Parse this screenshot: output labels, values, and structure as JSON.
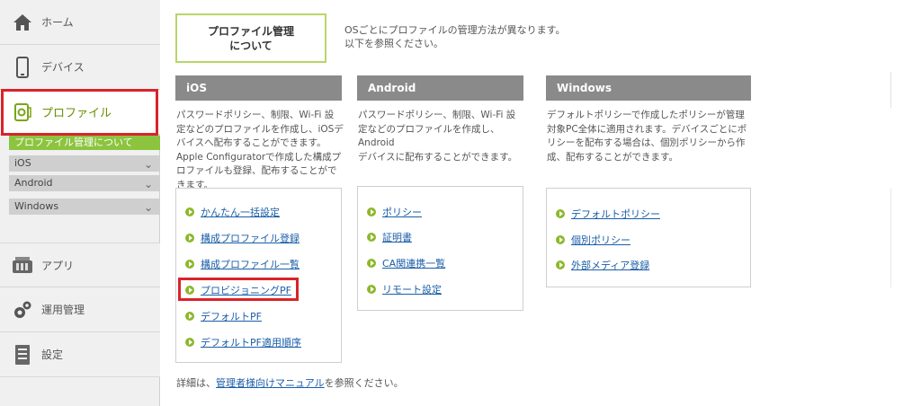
{
  "sidebar": {
    "items": [
      {
        "label": "ホーム",
        "icon": "home-icon"
      },
      {
        "label": "デバイス",
        "icon": "smartphone-icon"
      },
      {
        "label": "プロファイル",
        "icon": "profile-icon",
        "active": true
      },
      {
        "label": "アプリ",
        "icon": "apps-icon"
      },
      {
        "label": "運用管理",
        "icon": "gears-icon"
      },
      {
        "label": "設定",
        "icon": "settings-doc-icon"
      }
    ],
    "current_sub": "プロファイル管理について",
    "sub_items": [
      "iOS",
      "Android",
      "Windows"
    ]
  },
  "main": {
    "about_button": {
      "line1": "プロファイル管理",
      "line2": "について"
    },
    "intro": {
      "line1": "OSごとにプロファイルの管理方法が異なります。",
      "line2": "以下を参照ください。"
    },
    "columns": [
      {
        "header": "iOS",
        "desc": [
          "パスワードポリシー、制限、Wi-Fi 設",
          "定などのプロファイルを作成し、iOSデ",
          "バイスへ配布することができます。",
          "Apple Configuratorで作成した構成プ",
          "ロファイルも登録、配布することがで",
          "きます。"
        ],
        "links": [
          "かんたん一括設定",
          "構成プロファイル登録",
          "構成プロファイル一覧",
          "プロビジョニングPF",
          "デフォルトPF",
          "デフォルトPF適用順序"
        ]
      },
      {
        "header": "Android",
        "desc": [
          "パスワードポリシー、制限、Wi-Fi 設",
          "定などのプロファイルを作成し、Android",
          "デバイスに配布することができます。"
        ],
        "links": [
          "ポリシー",
          "証明書",
          "CA関連携一覧",
          "リモート設定"
        ]
      },
      {
        "header": "Windows",
        "desc": [
          "デフォルトポリシーで作成したポリシーが管理",
          "対象PC全体に適用されます。デバイスごとにポ",
          "リシーを配布する場合は、個別ポリシーから作",
          "成、配布することができます。"
        ],
        "links": [
          "デフォルトポリシー",
          "個別ポリシー",
          "外部メディア登録"
        ]
      }
    ],
    "footer": {
      "prefix": "詳細は、",
      "link": "管理者様向けマニュアル",
      "suffix": "を参照ください。"
    }
  },
  "colors": {
    "accent_green": "#8cc43f",
    "highlight_red": "#d9232a",
    "link_blue": "#1a5ea8",
    "header_gray": "#8a8a8a"
  }
}
